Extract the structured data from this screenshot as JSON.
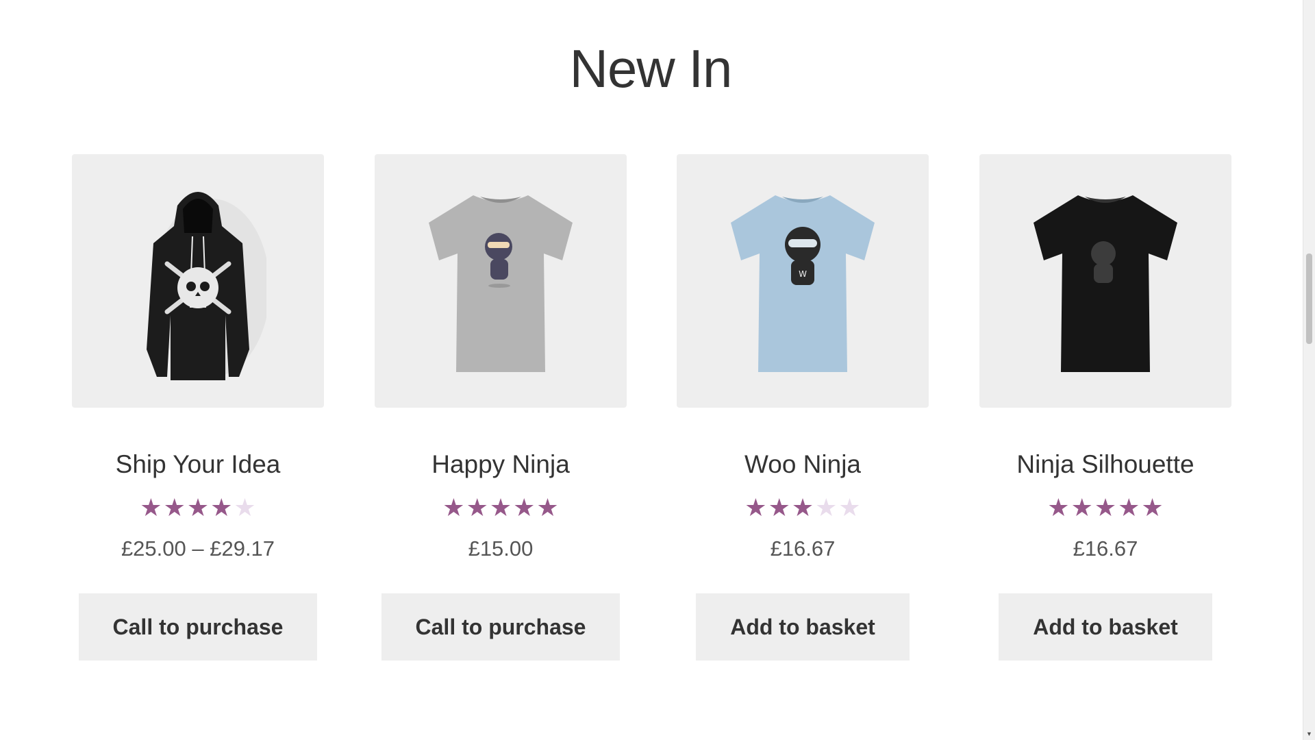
{
  "section": {
    "title": "New In"
  },
  "products": [
    {
      "name": "Ship Your Idea",
      "rating": 4,
      "price": "£25.00 – £29.17",
      "button": "Call to purchase",
      "image_icon": "hoodie-icon"
    },
    {
      "name": "Happy Ninja",
      "rating": 5,
      "price": "£15.00",
      "button": "Call to purchase",
      "image_icon": "tshirt-icon"
    },
    {
      "name": "Woo Ninja",
      "rating": 3,
      "price": "£16.67",
      "button": "Add to basket",
      "image_icon": "tshirt-icon"
    },
    {
      "name": "Ninja Silhouette",
      "rating": 5,
      "price": "£16.67",
      "button": "Add to basket",
      "image_icon": "tshirt-icon"
    }
  ],
  "rating_max": 5,
  "colors": {
    "star_filled": "#96588a",
    "star_empty": "#e9dcec",
    "image_bg": "#eeeeee",
    "button_bg": "#eeeeee",
    "text": "#333333"
  },
  "scrollbar": {
    "position": 0.35
  }
}
